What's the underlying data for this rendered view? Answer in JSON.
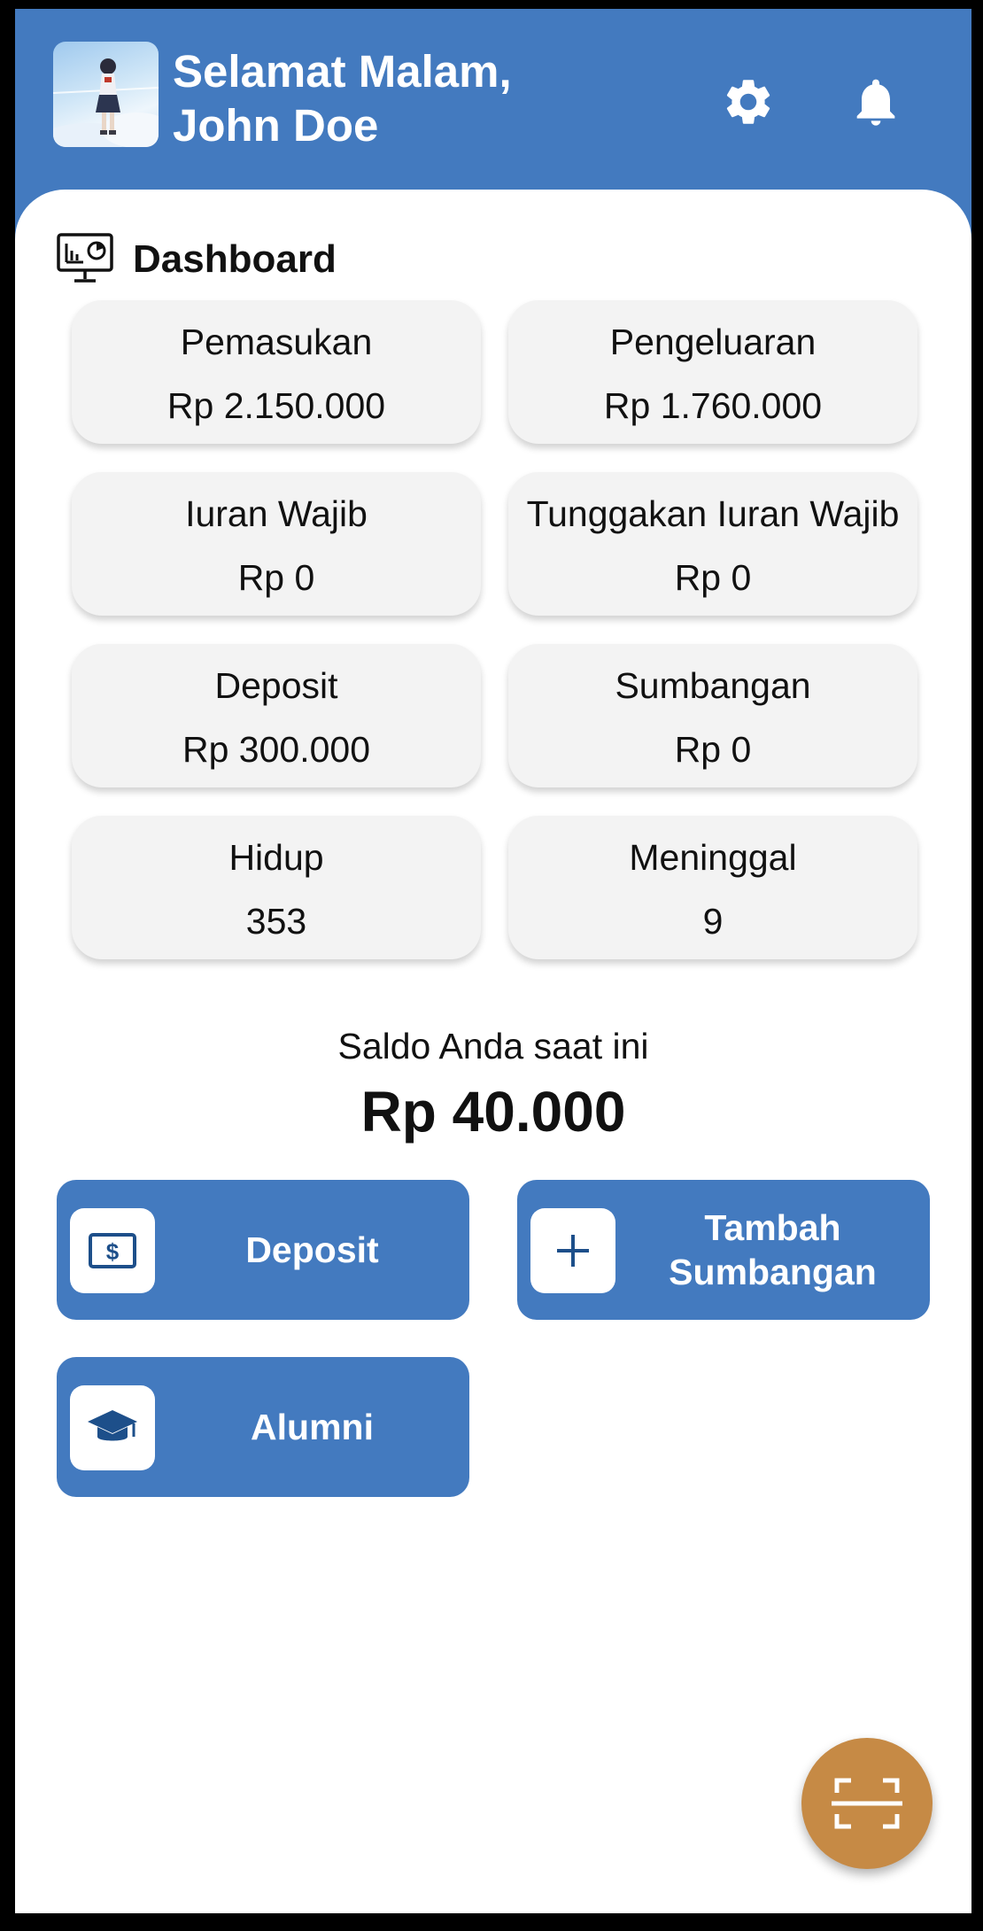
{
  "header": {
    "greeting_line1": "Selamat Malam,",
    "greeting_line2": "John Doe",
    "settings_icon": "gear-icon",
    "notification_icon": "bell-icon",
    "background_color": "#437abf"
  },
  "dashboard": {
    "title": "Dashboard",
    "icon": "presentation-chart-icon",
    "stats": [
      {
        "label": "Pemasukan",
        "value": "Rp 2.150.000"
      },
      {
        "label": "Pengeluaran",
        "value": "Rp 1.760.000"
      },
      {
        "label": "Iuran Wajib",
        "value": "Rp 0"
      },
      {
        "label": "Tunggakan Iuran Wajib",
        "value": "Rp 0"
      },
      {
        "label": "Deposit",
        "value": "Rp 300.000"
      },
      {
        "label": "Sumbangan",
        "value": "Rp 0"
      },
      {
        "label": "Hidup",
        "value": "353"
      },
      {
        "label": "Meninggal",
        "value": "9"
      }
    ]
  },
  "balance": {
    "label": "Saldo Anda saat ini",
    "value": "Rp 40.000"
  },
  "actions": [
    {
      "label": "Deposit",
      "icon": "dollar-bill-icon"
    },
    {
      "label": "Tambah Sumbangan",
      "icon": "plus-icon"
    },
    {
      "label": "Alumni",
      "icon": "graduation-cap-icon"
    }
  ],
  "fab": {
    "icon": "scan-icon",
    "color": "#c68a45"
  }
}
